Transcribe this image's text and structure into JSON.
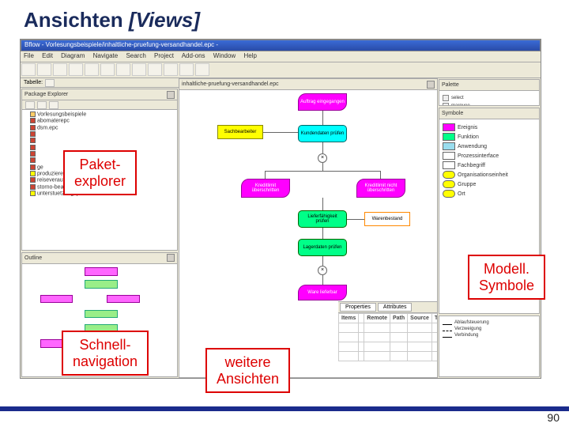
{
  "slide": {
    "title_main": "Ansichten ",
    "title_bracket": "[Views]",
    "page_number": "90"
  },
  "overlays": {
    "pkg_l1": "Paket-",
    "pkg_l2": "explorer",
    "sym_l1": "Modell.",
    "sym_l2": "Symbole",
    "nav_l1": "Schnell-",
    "nav_l2": "navigation",
    "more_l1": "weitere",
    "more_l2": "Ansichten"
  },
  "window": {
    "title": "Bflow - Vorlesungsbeispiele/inhaltliche-pruefung-versandhandel.epc -",
    "menu": [
      "File",
      "Edit",
      "Diagram",
      "Navigate",
      "Search",
      "Project",
      "Add-ons",
      "Window",
      "Help"
    ]
  },
  "panels": {
    "pkg_title": "Package Explorer",
    "outline_title": "Outline",
    "editor_tab": "inhaltliche-pruefung-versandhandel.epc",
    "props_tab1": "Properties",
    "props_tab2": "Attributes",
    "palette_title": "Palette",
    "symbols_title": "Symbole"
  },
  "tree": {
    "root": "Vorlesungsbeispiele",
    "items": [
      "abomaterepc",
      "dsm.epc",
      "",
      "",
      "",
      "",
      "",
      "produzierendes-unternehmen.vc",
      "reiseverauftragsteuerung.epc",
      "storno-bearbeitungsgruppe",
      "unterstuetzungsprozesse.vc"
    ],
    "more1": "ge",
    "more2": ""
  },
  "palette": {
    "items": [
      "select",
      "marquee"
    ]
  },
  "symbols": {
    "items": [
      {
        "label": "Ereignis",
        "color": "#f0f"
      },
      {
        "label": "Funktion",
        "color": "#0f8"
      },
      {
        "label": "Anwendung",
        "color": "#9de"
      },
      {
        "label": "Prozessinterface",
        "color": "#fff"
      },
      {
        "label": "Fachbegriff",
        "color": "#fff"
      },
      {
        "label": "Organisationseinheit",
        "color": "#ff0"
      },
      {
        "label": "Gruppe",
        "color": "#ff0"
      },
      {
        "label": "Ort",
        "color": "#ff0"
      }
    ]
  },
  "connections": {
    "title": "",
    "items": [
      {
        "label": "Ablaufsteuerung"
      },
      {
        "label": "Verzweigung"
      },
      {
        "label": "Verbindung"
      }
    ]
  },
  "diagram": {
    "ev1": "Auftrag eingegangen",
    "org1": "Sachbearbeiter",
    "fn1": "Kundendaten prüfen",
    "ev2": "Kreditlimit überschritten",
    "ev3": "Kreditlimit nicht überschritten",
    "fn2": "Lieferfähigkeit prüfen",
    "org2": "Warenbestand",
    "fn3": "Lagerdaten prüfen",
    "ev4": "Ware lieferbar"
  },
  "grid": {
    "headers": [
      "Items",
      "",
      "Remote",
      "Path",
      "Source",
      "Type"
    ]
  }
}
